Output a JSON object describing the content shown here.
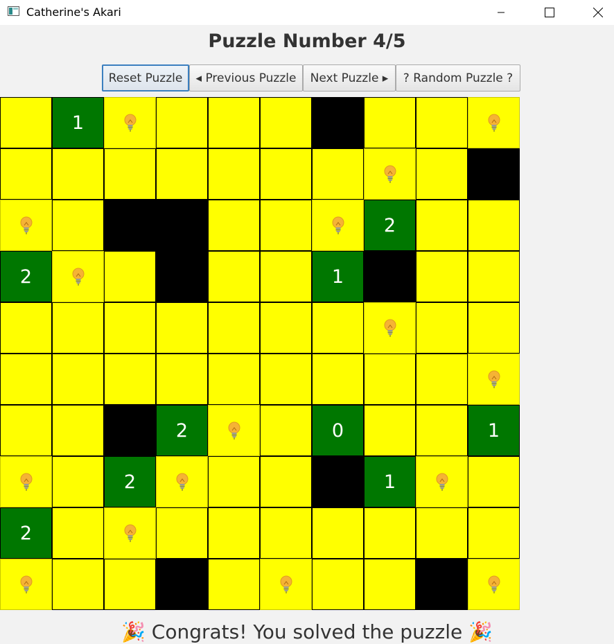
{
  "window": {
    "title": "Catherine's Akari",
    "controls": [
      "minimize",
      "maximize",
      "close"
    ]
  },
  "header": {
    "title": "Puzzle Number 4/5"
  },
  "toolbar": {
    "reset_label": "Reset Puzzle",
    "prev_label": "◂ Previous Puzzle",
    "next_label": "Next Puzzle ▸",
    "random_label": "? Random Puzzle ?"
  },
  "board": {
    "rows": [
      [
        "Y",
        "1",
        "L",
        "Y",
        "Y",
        "Y",
        "B",
        "Y",
        "Y",
        "L"
      ],
      [
        "Y",
        "Y",
        "Y",
        "Y",
        "Y",
        "Y",
        "Y",
        "L",
        "Y",
        "B"
      ],
      [
        "L",
        "Y",
        "B",
        "B",
        "Y",
        "Y",
        "L",
        "2",
        "Y",
        "Y"
      ],
      [
        "2",
        "L",
        "Y",
        "B",
        "Y",
        "Y",
        "1",
        "B",
        "Y",
        "Y"
      ],
      [
        "Y",
        "Y",
        "Y",
        "Y",
        "Y",
        "Y",
        "Y",
        "L",
        "Y",
        "Y"
      ],
      [
        "Y",
        "Y",
        "Y",
        "Y",
        "Y",
        "Y",
        "Y",
        "Y",
        "Y",
        "L"
      ],
      [
        "Y",
        "Y",
        "B",
        "2",
        "L",
        "Y",
        "0",
        "Y",
        "Y",
        "1"
      ],
      [
        "L",
        "Y",
        "2",
        "L",
        "Y",
        "Y",
        "B",
        "1",
        "L",
        "Y"
      ],
      [
        "2",
        "Y",
        "L",
        "Y",
        "Y",
        "Y",
        "Y",
        "Y",
        "Y",
        "Y"
      ],
      [
        "L",
        "Y",
        "Y",
        "B",
        "Y",
        "L",
        "Y",
        "Y",
        "B",
        "L"
      ]
    ],
    "legend": {
      "Y": "lit",
      "L": "bulb",
      "B": "black",
      "digit": "numbered-clue"
    },
    "colors": {
      "lit": "#ffff00",
      "black": "#000000",
      "clue": "#007700",
      "bulb": "#f5a623"
    }
  },
  "status": {
    "message": "🎉 Congrats! You solved the puzzle 🎉"
  }
}
